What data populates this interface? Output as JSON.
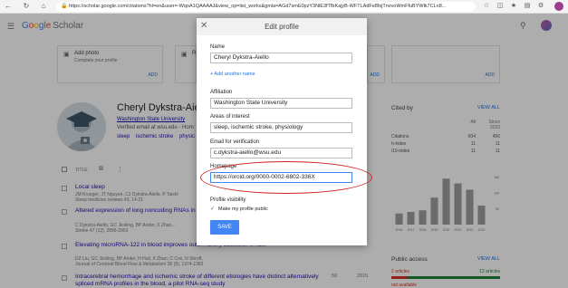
{
  "browser": {
    "url": "https://scholar.google.com/citations?hl=en&user=-WqoA1QAAAAJ&view_op=list_works&gmla=AGd7smE0pzY3NlE3fTfbKajyB-WFTLAdFe8fsjTnvvoWmFfuBYWlk7CLn8...",
    "nav_icons": [
      "back-arrow-icon",
      "reload-icon",
      "home-icon"
    ]
  },
  "header": {
    "logo_parts": [
      "G",
      "o",
      "o",
      "g",
      "l",
      "e"
    ],
    "logo_suffix": "Scholar"
  },
  "cards": [
    {
      "title": "Add photo",
      "subtitle": "Complete your profile",
      "action": "ADD"
    },
    {
      "title": "Ra",
      "subtitle": "",
      "action": "ADD"
    },
    {
      "title": "",
      "subtitle": "",
      "action": "ADD"
    }
  ],
  "profile": {
    "name": "Cheryl Dykstra-Aiell",
    "affiliation": "Washington State University",
    "verified": "Verified email at wsu.edu - Hom",
    "tags": [
      "sleep",
      "ischemic stroke",
      "physic"
    ]
  },
  "table": {
    "title_header": "TITLE",
    "articles": [
      {
        "title": "Local sleep",
        "authors": "JM Krueger, JT Nguyen, CJ Dykstra-Aiello, P Taishi",
        "venue": "Sleep medicine reviews 43, 14-21",
        "cites": "",
        "year": ""
      },
      {
        "title": "Altered expression of long noncoding RNAs in ... to putative stroke risk loci",
        "authors": "C Dykstra-Aiello, GC Jickling, BP Ander, X Zhan...",
        "venue": "Stroke 47 (12), 2896-2903",
        "cites": "",
        "year": ""
      },
      {
        "title": "Elevating microRNA-122 in blood improves outc... artery occlusion in rats",
        "authors": "DZ Liu, GC Jickling, BP Ander, H Hull, X Zhan, C Cox, N Shroff,",
        "venue": "Journal of Cerebral Blood Flow & Metabolism 36 (8), 1374-1383",
        "cites": "",
        "year": ""
      },
      {
        "title": "Intracerebral hemorrhage and ischemic stroke of different etiologies have distinct alternatively spliced mRNA profiles in the blood, a pilot RNA-seq study",
        "authors": "",
        "venue": "",
        "cites": "59",
        "year": "2015"
      }
    ]
  },
  "cited_by": {
    "heading": "Cited by",
    "view_all": "VIEW ALL",
    "columns": [
      "All",
      "Since 2020"
    ],
    "rows": [
      {
        "label": "Citations",
        "all": "604",
        "since": "456"
      },
      {
        "label": "h-index",
        "all": "11",
        "since": "11"
      },
      {
        "label": "i10-index",
        "all": "11",
        "since": "11"
      }
    ]
  },
  "chart_data": {
    "type": "bar",
    "categories": [
      "2016",
      "2017",
      "2018",
      "2019",
      "2020",
      "2021",
      "2022",
      "2023"
    ],
    "values": [
      35,
      40,
      45,
      85,
      145,
      130,
      110,
      60
    ],
    "ylim": [
      0,
      160
    ],
    "y_ticks": [
      "150",
      "100",
      "50"
    ],
    "bar_color": "#9e9e9e",
    "grid": false
  },
  "public_access": {
    "heading": "Public access",
    "view_all": "VIEW ALL",
    "not_available": "2 articles",
    "available": "12 articles",
    "available_fraction": 0.86,
    "footer": "not available"
  },
  "dialog": {
    "title": "Edit profile",
    "close_icon": "close-icon",
    "name_label": "Name",
    "name_value": "Cheryl Dykstra-Aiello",
    "add_name_link": "+ Add another name",
    "affiliation_label": "Affiliation",
    "affiliation_value": "Washington State University",
    "interests_label": "Areas of interest",
    "interests_value": "sleep, ischemic stroke, physiology",
    "email_label": "Email for verification",
    "email_value": "c.dykstra-aiello@wsu.edu",
    "homepage_label": "Homepage",
    "homepage_value": "https://orcid.org/0000-0002-6802-336X",
    "visibility_label": "Profile visibility",
    "visibility_check": "Make my profile public",
    "save_label": "SAVE",
    "accent": "#4285f4",
    "annotation_color": "#d0202a"
  }
}
